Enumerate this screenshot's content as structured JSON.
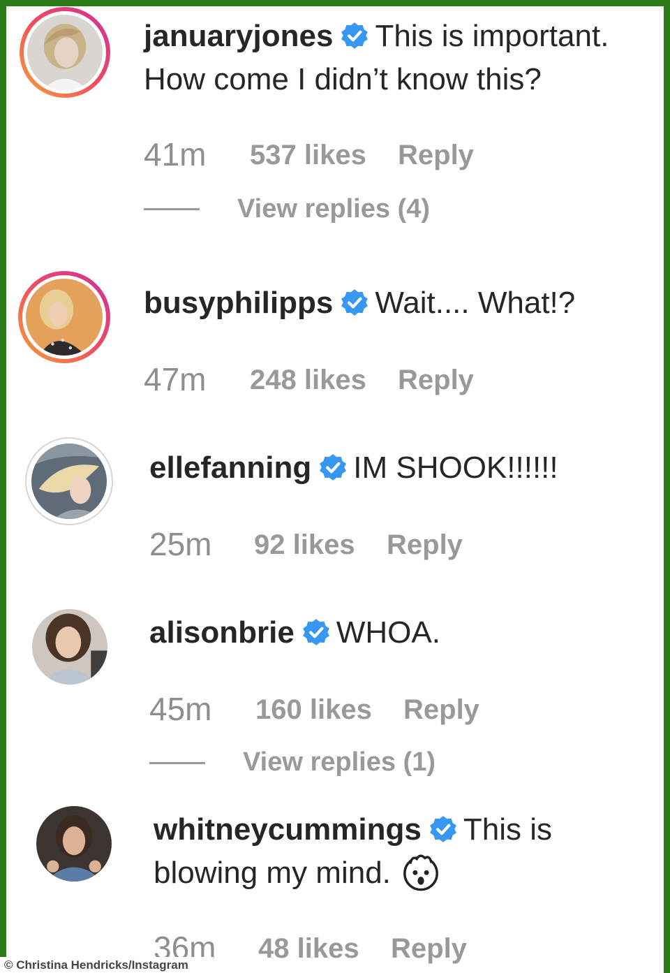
{
  "comments": [
    {
      "username": "januaryjones",
      "text_line1": "This is important.",
      "text_line2": "How come I didn’t know this?",
      "time": "41m",
      "likes": "537 likes",
      "reply": "Reply",
      "view_replies": "View replies (4)",
      "story_ring": true
    },
    {
      "username": "busyphilipps",
      "text_line1": "Wait.... What!?",
      "time": "47m",
      "likes": "248 likes",
      "reply": "Reply",
      "story_ring": true
    },
    {
      "username": "ellefanning",
      "text_line1": "IM SHOOK!!!!!!",
      "time": "25m",
      "likes": "92 likes",
      "reply": "Reply",
      "story_ring": false
    },
    {
      "username": "alisonbrie",
      "text_line1": "WHOA.",
      "time": "45m",
      "likes": "160 likes",
      "reply": "Reply",
      "view_replies": "View replies (1)",
      "story_ring": false
    },
    {
      "username": "whitneycummings",
      "text_line1": "This is",
      "text_line2": "blowing my mind.",
      "emoji": "exploding-head-emoji",
      "time": "36m",
      "likes": "48 likes",
      "reply": "Reply",
      "story_ring": false
    }
  ],
  "credit": "© Christina Hendricks/Instagram",
  "icons": {
    "verified": "verified-badge-icon"
  },
  "colors": {
    "frame_border": "#2b7a17",
    "verified_blue": "#3897f0",
    "meta_grey": "#8e8e8e",
    "text": "#262626"
  }
}
